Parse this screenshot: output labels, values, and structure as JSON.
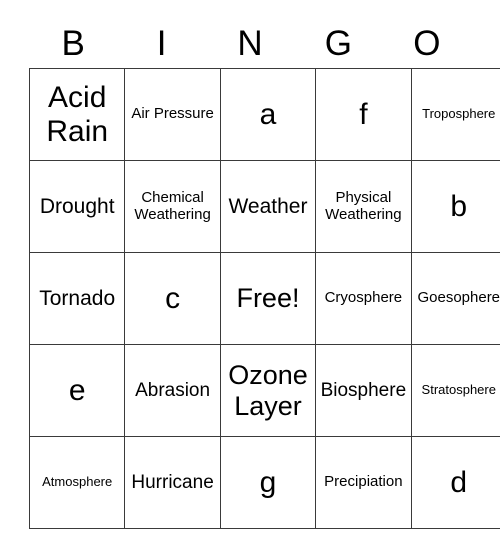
{
  "card": {
    "headers": [
      "B",
      "I",
      "N",
      "G",
      "O"
    ],
    "rows": [
      [
        {
          "text": "Acid Rain",
          "size": "xl"
        },
        {
          "text": "Air Pressure",
          "size": "xs"
        },
        {
          "text": "a",
          "size": "xl"
        },
        {
          "text": "f",
          "size": "xl"
        },
        {
          "text": "Troposphere",
          "size": "xxs"
        }
      ],
      [
        {
          "text": "Drought",
          "size": "md"
        },
        {
          "text": "Chemical Weathering",
          "size": "xs"
        },
        {
          "text": "Weather",
          "size": "md"
        },
        {
          "text": "Physical Weathering",
          "size": "xs"
        },
        {
          "text": "b",
          "size": "xl"
        }
      ],
      [
        {
          "text": "Tornado",
          "size": "md"
        },
        {
          "text": "c",
          "size": "xl"
        },
        {
          "text": "Free!",
          "size": "lg"
        },
        {
          "text": "Cryosphere",
          "size": "xs"
        },
        {
          "text": "Goesophere",
          "size": "xs"
        }
      ],
      [
        {
          "text": "e",
          "size": "xl"
        },
        {
          "text": "Abrasion",
          "size": "sm"
        },
        {
          "text": "Ozone Layer",
          "size": "lg"
        },
        {
          "text": "Biosphere",
          "size": "sm"
        },
        {
          "text": "Stratosphere",
          "size": "xxs"
        }
      ],
      [
        {
          "text": "Atmosphere",
          "size": "xxs"
        },
        {
          "text": "Hurricane",
          "size": "sm"
        },
        {
          "text": "g",
          "size": "xl"
        },
        {
          "text": "Precipiation",
          "size": "xs"
        },
        {
          "text": "d",
          "size": "xl"
        }
      ]
    ]
  },
  "colors": {
    "text": "#000000",
    "border": "#3a3a3a",
    "background": "#ffffff"
  }
}
